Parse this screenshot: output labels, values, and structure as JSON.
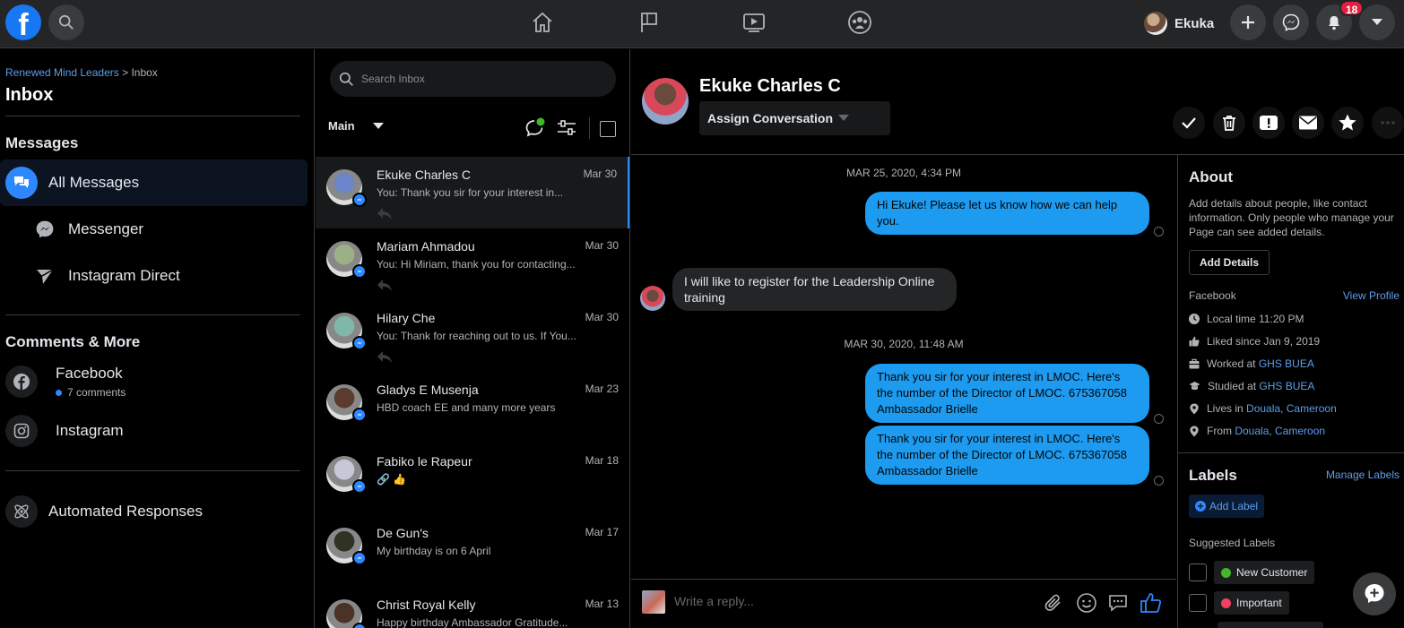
{
  "topbar": {
    "logo": "f",
    "profile_name": "Ekuka",
    "notifications_count": "18"
  },
  "sidebar": {
    "breadcrumb_link": "Renewed Mind Leaders",
    "breadcrumb_sep": " > ",
    "breadcrumb_current": "Inbox",
    "title": "Inbox",
    "messages_section": "Messages",
    "items": [
      {
        "label": "All Messages",
        "icon": "chat-bubbles-icon"
      },
      {
        "label": "Messenger",
        "icon": "messenger-icon"
      },
      {
        "label": "Instagram Direct",
        "icon": "instagram-direct-icon"
      }
    ],
    "comments_section": "Comments & More",
    "facebook_label": "Facebook",
    "facebook_sub": "7 comments",
    "instagram_label": "Instagram",
    "automated_label": "Automated Responses"
  },
  "convlist": {
    "search_placeholder": "Search Inbox",
    "folder": "Main",
    "conversations": [
      {
        "name": "Ekuke Charles C",
        "date": "Mar 30",
        "snippet": "You: Thank you sir for your interest in...",
        "replied": true,
        "active": true,
        "color": "#6a86c8"
      },
      {
        "name": "Mariam Ahmadou",
        "date": "Mar 30",
        "snippet": "You: Hi Miriam, thank you for contacting...",
        "replied": true,
        "active": false,
        "color": "#9bb087"
      },
      {
        "name": "Hilary Che",
        "date": "Mar 30",
        "snippet": "You: Thank for reaching out to us. If You...",
        "replied": true,
        "active": false,
        "color": "#7fb8a8"
      },
      {
        "name": "Gladys E Musenja",
        "date": "Mar 23",
        "snippet": "HBD coach EE and many more years",
        "replied": false,
        "active": false,
        "color": "#5a3b2e"
      },
      {
        "name": "Fabiko le Rapeur",
        "date": "Mar 18",
        "snippet": "🔗 👍",
        "replied": false,
        "active": false,
        "color": "#c7c7d8"
      },
      {
        "name": "De Gun's",
        "date": "Mar 17",
        "snippet": "My birthday is on 6 April",
        "replied": false,
        "active": false,
        "color": "#2e3324"
      },
      {
        "name": "Christ Royal Kelly",
        "date": "Mar 13",
        "snippet": "Happy birthday Ambassador Gratitude...",
        "replied": false,
        "active": false,
        "color": "#4a3226"
      }
    ]
  },
  "thread": {
    "name": "Ekuke Charles C",
    "assign_label": "Assign Conversation",
    "timestamp_1": "MAR 25, 2020, 4:34 PM",
    "msg_out_1": "Hi Ekuke! Please let us know how we can help you.",
    "msg_in_1": "I will like to register for the Leadership Online training",
    "timestamp_2": "MAR 30, 2020, 11:48 AM",
    "msg_out_2": "Thank you sir for your interest in LMOC. Here's the number of the Director of LMOC. 675367058 Ambassador Brielle",
    "msg_out_3": "Thank you sir for your interest in LMOC. Here's the number of the Director of LMOC. 675367058 Ambassador Brielle",
    "reply_placeholder": "Write a reply..."
  },
  "about": {
    "title": "About",
    "description": "Add details about people, like contact information. Only people who manage your Page can see added details.",
    "add_details": "Add Details",
    "source_label": "Facebook",
    "view_profile": "View Profile",
    "local_time": "Local time 11:20 PM",
    "liked_since": "Liked since Jan 9, 2019",
    "worked_prefix": "Worked at ",
    "worked_at": "GHS BUEA",
    "studied_prefix": "Studied at ",
    "studied_at": "GHS BUEA",
    "lives_prefix": "Lives in ",
    "lives_in": "Douala, Cameroon",
    "from_prefix": "From ",
    "from": "Douala, Cameroon"
  },
  "labels": {
    "title": "Labels",
    "manage": "Manage Labels",
    "add_label": "Add Label",
    "suggested_title": "Suggested Labels",
    "suggested": [
      {
        "name": "New Customer",
        "color": "#42b72a"
      },
      {
        "name": "Important",
        "color": "#f3425f"
      }
    ]
  },
  "colors": {
    "accent": "#2d88ff",
    "outgoing_bubble": "#1d9bf0",
    "badge": "#e41e3f"
  }
}
